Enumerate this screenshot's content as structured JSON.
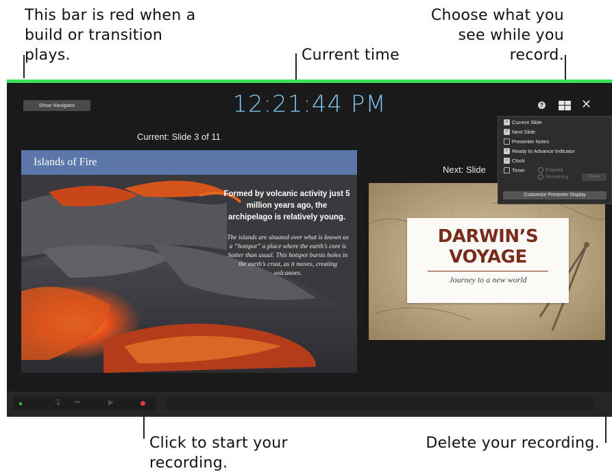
{
  "callouts": {
    "build_bar": "This bar is red when a build or transition plays.",
    "current_time": "Current time",
    "choose_view": "Choose what you see while you record.",
    "start_recording": "Click to start your recording.",
    "delete_recording": "Delete your recording."
  },
  "colors": {
    "build_bar": "#3be05a",
    "clock": "#7ec3ee",
    "window_bg": "#1a1a1a",
    "record_button": "#e23a3a"
  },
  "header": {
    "show_navigator": "Show Navigator",
    "clock": "12:21:44 PM",
    "icons": [
      "help-icon",
      "layout-icon",
      "close-icon"
    ]
  },
  "current": {
    "label": "Current: Slide 3 of 11",
    "slide_title": "Islands of Fire",
    "heading": "Formed by volcanic activity just 5 million years ago, the archipelago is relatively young.",
    "body": "The islands are situated over what is known as a “hotspot” a place where the earth’s core is hotter than usual. This hotspot bursts holes in the earth’s crust, as it moves, creating volcanoes."
  },
  "next": {
    "label": "Next: Slide",
    "title": "DARWIN’S VOYAGE",
    "subtitle": "Journey to a new world"
  },
  "display_menu": {
    "options": [
      {
        "label": "Current Slide",
        "checked": true
      },
      {
        "label": "Next Slide",
        "checked": true
      },
      {
        "label": "Presenter Notes",
        "checked": false
      },
      {
        "label": "Ready to Advance Indicator",
        "checked": true
      },
      {
        "label": "Clock",
        "checked": true
      },
      {
        "label": "Timer",
        "checked": false
      }
    ],
    "timer_modes": [
      "Elapsed",
      "Remaining"
    ],
    "reset_label": "Reset",
    "customize_label": "Customize Presenter Display"
  }
}
